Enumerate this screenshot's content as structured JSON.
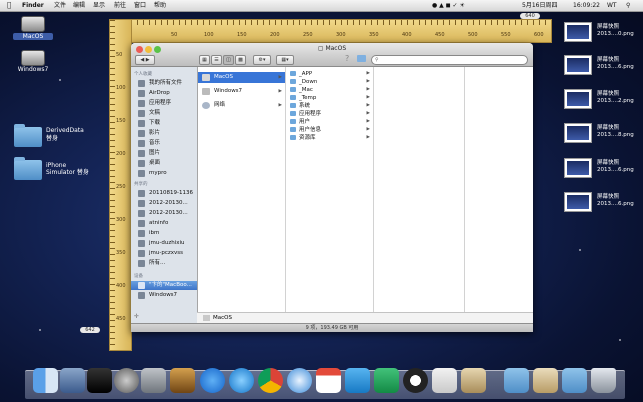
{
  "menubar": {
    "app": "Finder",
    "menus": [
      "文件",
      "编辑",
      "显示",
      "前往",
      "窗口",
      "帮助"
    ],
    "right": {
      "datetime": "5月16日周四",
      "time": "16:09:22",
      "user": "WT"
    }
  },
  "desktop": {
    "left_icons": [
      {
        "label": "MacOS",
        "kind": "drive"
      },
      {
        "label": "Windows7",
        "kind": "drive"
      },
      {
        "label": "DerivedData",
        "sub": "替身",
        "kind": "folder"
      },
      {
        "label": "iPhone",
        "sub": "Simulator 替身",
        "kind": "folder"
      }
    ],
    "right_icons": [
      {
        "line1": "屏幕快照",
        "line2": "2013....0.png"
      },
      {
        "line1": "屏幕快照",
        "line2": "2013....6.png"
      },
      {
        "line1": "屏幕快照",
        "line2": "2013....2.png"
      },
      {
        "line1": "屏幕快照",
        "line2": "2013....8.png"
      },
      {
        "line1": "屏幕快照",
        "line2": "2013....6.png"
      },
      {
        "line1": "屏幕快照",
        "line2": "2013....6.png"
      }
    ],
    "ruler_top_label": "640",
    "ruler_left_label": "642"
  },
  "ruler": {
    "h": [
      "50",
      "100",
      "150",
      "200",
      "250",
      "300",
      "350",
      "400",
      "450",
      "500",
      "550",
      "600"
    ],
    "v": [
      "50",
      "100",
      "150",
      "200",
      "250",
      "300",
      "350",
      "400",
      "450"
    ]
  },
  "finder": {
    "title": "MacOS",
    "search_placeholder": "",
    "sidebar": {
      "favorites_header": "个人收藏",
      "favorites": [
        "我的所有文件",
        "AirDrop",
        "应用程序",
        "文稿",
        "下载",
        "影片",
        "音乐",
        "图片",
        "桌面",
        "mypro"
      ],
      "shared_header": "共享的",
      "shared": [
        "20110819-1136",
        "2012-20130...",
        "2012-20130...",
        "atninfo",
        "ibm",
        "jmu-duzhixiu",
        "jmu-pczxvss",
        "所有..."
      ],
      "devices_header": "设备",
      "devices": [
        "\"卞的\"MacBoo...",
        "Windows7"
      ]
    },
    "column1": [
      {
        "label": "MacOS",
        "selected": true
      },
      {
        "label": "Windows7",
        "selected": false
      },
      {
        "label": "网络",
        "selected": false
      }
    ],
    "column2": [
      "_APP",
      "_Down",
      "_Mac",
      "_Temp",
      "系统",
      "应用程序",
      "用户",
      "用户信息",
      "资源库"
    ],
    "pathbar": "MacOS",
    "status": "9 项，193.49 GB 可用"
  },
  "dock": {
    "apps": [
      "Finder",
      "Xcode",
      "iPhone",
      "Launchpad",
      "Keychain",
      "Photo",
      "App Store",
      "iTunes",
      "Chrome",
      "Safari",
      "Calendar",
      "WPS",
      "Excel",
      "QQ",
      "TextEdit",
      "Preview",
      "Folder",
      "Archive",
      "Documents",
      "Trash"
    ]
  },
  "colors": {
    "selection": "#3875d7",
    "sidebar_bg": "#dde3ea",
    "ruler": "#e5c76f"
  }
}
